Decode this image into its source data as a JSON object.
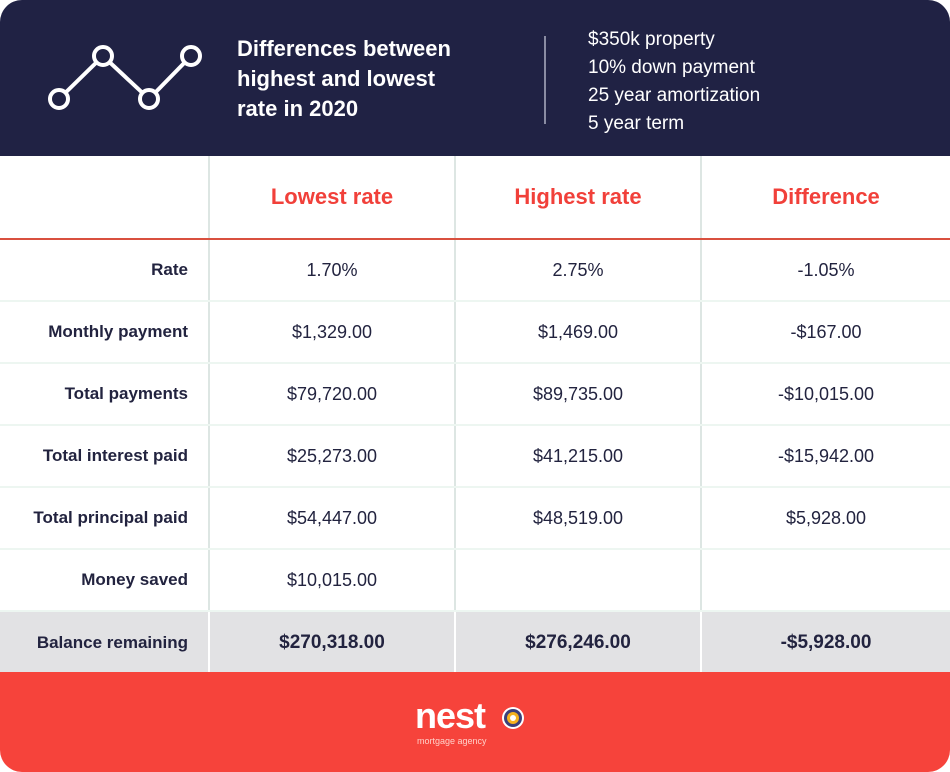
{
  "header": {
    "icon": "line-chart-icon",
    "title_lines": [
      "Differences between",
      "highest and lowest",
      "rate in 2020"
    ],
    "specs": [
      "$350k property",
      "10% down payment",
      "25 year amortization",
      "5 year term"
    ]
  },
  "colors": {
    "header_bg": "#202244",
    "accent_red": "#f6433b",
    "column_header_red": "#f1403a",
    "text_dark": "#22233f",
    "total_row_bg": "#e2e2e4"
  },
  "table": {
    "columns": [
      "",
      "Lowest rate",
      "Highest rate",
      "Difference"
    ],
    "rows": [
      {
        "label": "Rate",
        "lowest": "1.70%",
        "highest": "2.75%",
        "difference": "-1.05%"
      },
      {
        "label": "Monthly payment",
        "lowest": "$1,329.00",
        "highest": "$1,469.00",
        "difference": "-$167.00"
      },
      {
        "label": "Total payments",
        "lowest": "$79,720.00",
        "highest": "$89,735.00",
        "difference": "-$10,015.00"
      },
      {
        "label": "Total interest paid",
        "lowest": "$25,273.00",
        "highest": "$41,215.00",
        "difference": "-$15,942.00"
      },
      {
        "label": "Total principal paid",
        "lowest": "$54,447.00",
        "highest": "$48,519.00",
        "difference": "$5,928.00"
      },
      {
        "label": "Money saved",
        "lowest": "$10,015.00",
        "highest": "",
        "difference": ""
      }
    ],
    "total": {
      "label": "Balance remaining",
      "lowest": "$270,318.00",
      "highest": "$276,246.00",
      "difference": "-$5,928.00"
    }
  },
  "footer": {
    "logo_text": "nest",
    "logo_mark": "target-o-icon",
    "tagline": "mortgage agency"
  }
}
